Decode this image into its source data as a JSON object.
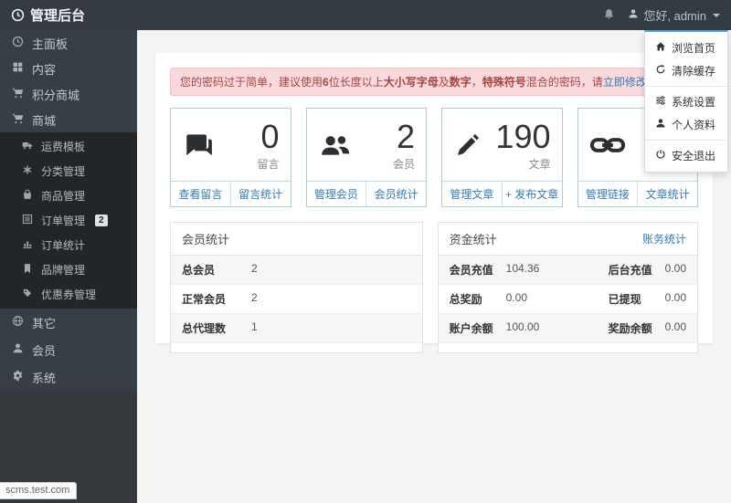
{
  "topbar": {
    "title": "管理后台",
    "greeting": "您好, admin"
  },
  "sidebar": {
    "main_items": [
      {
        "label": "主面板"
      },
      {
        "label": "内容"
      },
      {
        "label": "积分商城"
      },
      {
        "label": "商城"
      }
    ],
    "sub_items": [
      {
        "label": "运费模板"
      },
      {
        "label": "分类管理"
      },
      {
        "label": "商品管理"
      },
      {
        "label": "订单管理",
        "badge": "2"
      },
      {
        "label": "订单统计"
      },
      {
        "label": "品牌管理"
      },
      {
        "label": "优惠券管理"
      }
    ],
    "bottom_items": [
      {
        "label": "其它"
      },
      {
        "label": "会员"
      },
      {
        "label": "系统"
      }
    ]
  },
  "dropdown": {
    "items": [
      {
        "label": "浏览首页"
      },
      {
        "label": "清除缓存"
      },
      {
        "label": "系统设置"
      },
      {
        "label": "个人资料"
      },
      {
        "label": "安全退出"
      }
    ]
  },
  "alert": {
    "text_1": "您的密码过于简单，建议使用",
    "bold_1": "6",
    "text_2": "位长度以上",
    "bold_2": "大小写字母",
    "text_3": "及",
    "bold_3": "数字",
    "text_4": "，",
    "bold_4": "特殊符号",
    "text_5": "混合的密码，请",
    "link": "立即修改",
    "text_6": "!"
  },
  "cards": [
    {
      "value": "0",
      "label": "留言",
      "link_1": "查看留言",
      "link_2": "留言统计"
    },
    {
      "value": "2",
      "label": "会员",
      "link_1": "管理会员",
      "link_2": "会员统计"
    },
    {
      "value": "190",
      "label": "文章",
      "link_1": "管理文章",
      "link_2": "+ 发布文章"
    },
    {
      "value": "",
      "label": "链接",
      "link_1": "管理链接",
      "link_2": "文章统计"
    }
  ],
  "member_panel": {
    "title": "会员统计",
    "rows": [
      {
        "label": "总会员",
        "value": "2"
      },
      {
        "label": "正常会员",
        "value": "2"
      },
      {
        "label": "总代理数",
        "value": "1"
      }
    ]
  },
  "funds_panel": {
    "title": "资金统计",
    "head_link": "账务统计",
    "rows": [
      {
        "l1": "会员充值",
        "v1": "104.36",
        "l2": "后台充值",
        "v2": "0.00"
      },
      {
        "l1": "总奖励",
        "v1": "0.00",
        "l2": "已提现",
        "v2": "0.00"
      },
      {
        "l1": "账户余额",
        "v1": "100.00",
        "l2": "奖励余额",
        "v2": "0.00"
      }
    ]
  },
  "statusbar": {
    "url": "scms.test.com"
  },
  "colors": {
    "accent_blue": "#337ab7",
    "alert_text": "#a94442",
    "card_border": "#aad1cf",
    "dropdown_top": "#51a5dc"
  }
}
